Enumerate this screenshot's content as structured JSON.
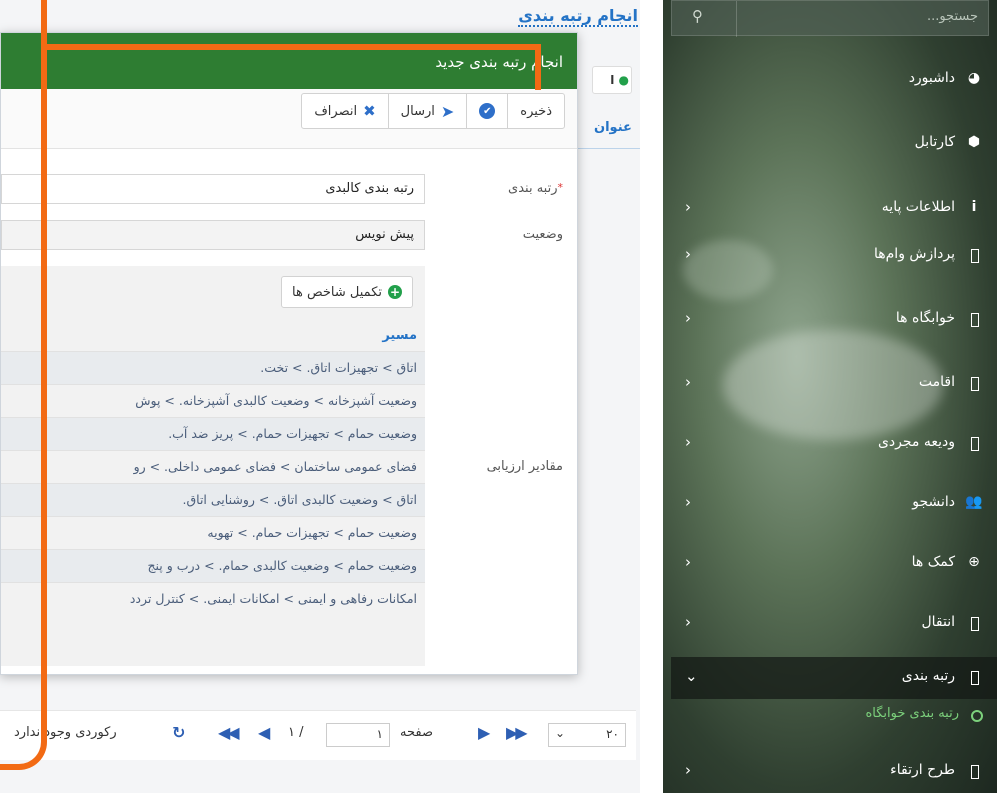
{
  "page": {
    "title": "انجام رتبه بندی",
    "add_label": "ا",
    "col_header": "عنوان"
  },
  "modal": {
    "title": "انجام رتبه بندی جدید",
    "toolbar": {
      "save": "ذخیره",
      "send": "ارسال",
      "cancel": "انصراف"
    },
    "fields": {
      "ranking_label": "رتبه بندی",
      "ranking_value": "رتبه بندی کالبدی",
      "status_label": "وضعیت",
      "status_value": "پیش نویس",
      "eval_label": "مقادیر ارزیابی"
    },
    "complete_button": "تکمیل شاخص ها",
    "path_header": "مسیر",
    "paths": [
      "اتاق > تجهیزات اتاق. > تخت.",
      "وضعیت آشپزخانه > وضعیت کالبدی آشپزخانه. > پوش",
      "وضعیت حمام > تجهیزات حمام. > پریز ضد آب.",
      "فضای عمومی ساختمان > فضای عمومی داخلی. > رو",
      "اتاق > وضعیت کالبدی اتاق. > روشنایی اتاق.",
      "وضعیت حمام > تجهیزات حمام. > تهویه",
      "وضعیت حمام > وضعیت کالبدی حمام. > درب و پنج",
      "امکانات رفاهی و ایمنی > امکانات ایمنی. > کنترل تردد"
    ]
  },
  "pager": {
    "page_size": "۲۰",
    "page_label": "صفحه",
    "page_value": "۱",
    "page_total": "/ ۱",
    "no_records": "رکوردی وجود ندارد"
  },
  "sidebar": {
    "search_placeholder": "جستجو...",
    "items": [
      {
        "label": "داشبورد"
      },
      {
        "label": "کارتابل"
      },
      {
        "label": "اطلاعات پایه"
      },
      {
        "label": "پردازش وام‌ها"
      },
      {
        "label": "خوابگاه ها"
      },
      {
        "label": "اقامت"
      },
      {
        "label": "ودیعه مجردی"
      },
      {
        "label": "دانشجو"
      },
      {
        "label": "کمک ها"
      },
      {
        "label": "انتقال"
      },
      {
        "label": "رتبه بندی"
      },
      {
        "label": "طرح ارتقاء"
      }
    ],
    "sub_item": "رتبه بندی خوابگاه"
  },
  "colors": {
    "modal_header": "#2e7d32",
    "link_blue": "#2473c6",
    "annotation_orange": "#f26a14",
    "active_sub": "#7cd17c"
  }
}
